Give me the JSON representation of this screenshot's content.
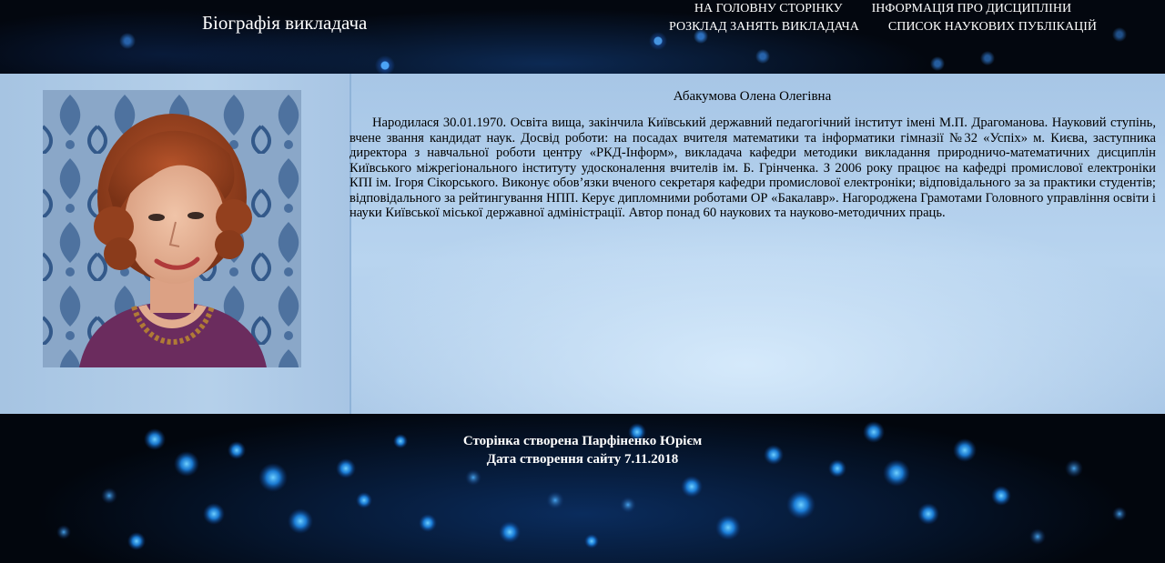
{
  "header": {
    "site_title": "Біографія викладача",
    "nav": [
      {
        "label": "НА ГОЛОВНУ СТОРІНКУ"
      },
      {
        "label": "ІНФОРМАЦІЯ ПРО ДИСЦИПЛІНИ"
      },
      {
        "label": "РОЗКЛАД ЗАНЯТЬ ВИКЛАДАЧА"
      },
      {
        "label": "СПИСОК НАУКОВИХ ПУБЛІКАЦІЙ"
      }
    ]
  },
  "profile": {
    "name": "Абакумова Олена Олегівна",
    "bio": "Народилася 30.01.1970. Освіта вища, закінчила Київський державний педагогічний інститут імені М.П. Драгоманова. Науковий ступінь, вчене звання кандидат наук. Досвід роботи: на посадах вчителя математики та інформатики гімназії №32 «Успіх» м. Києва, заступника директора з навчальної роботи центру «РКД-Інформ», викладача кафедри методики викладання природничо-математичних дисциплін Київського міжрегіонального інституту удосконалення вчителів ім. Б. Грінченка. З 2006 року працює на кафедрі промислової електроніки КПІ ім. Ігоря Сікорського. Виконує обов’язки вченого секретаря кафедри промислової електроніки; відповідального за за практики студентів; відповідального за рейтингування НПП. Керує дипломними роботами ОР «Бакалавр». Нагороджена Грамотами Головного управління освіти і науки Київської міської державної адміністрації. Автор понад 60 наукових та науково-методичних праць."
  },
  "footer": {
    "created_by": "Сторінка створена Парфіненко Юрієм",
    "created_date": "Дата створення сайту 7.11.2018"
  },
  "colors": {
    "main_background": "#b8d4ef",
    "header_background": "#03070f",
    "text": "#000000",
    "nav_text": "#ffffff"
  }
}
